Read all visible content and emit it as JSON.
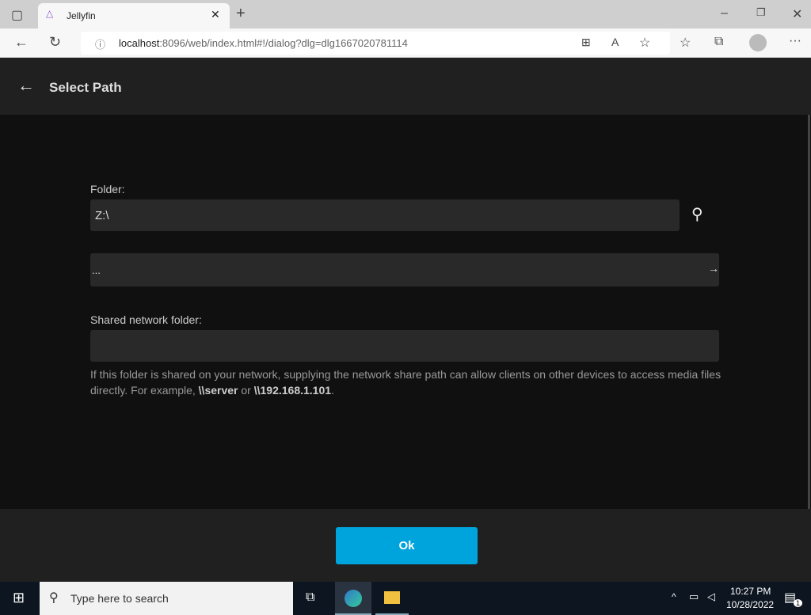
{
  "browser": {
    "tab_title": "Jellyfin",
    "url_host": "localhost",
    "url_rest": ":8096/web/index.html#!/dialog?dlg=dlg1667020781114"
  },
  "header": {
    "title": "Select Path"
  },
  "form": {
    "folder_label": "Folder:",
    "folder_value": "Z:\\",
    "parent_item": "...",
    "share_label": "Shared network folder:",
    "share_value": "",
    "help_prefix": "If this folder is shared on your network, supplying the network share path can allow clients on other devices to access media files directly. For example, ",
    "help_ex1": "\\\\server",
    "help_mid": " or ",
    "help_ex2": "\\\\192.168.1.101",
    "help_end": "."
  },
  "footer": {
    "ok_label": "Ok"
  },
  "taskbar": {
    "search_placeholder": "Type here to search",
    "time": "10:27 PM",
    "date": "10/28/2022",
    "notification_count": "1"
  }
}
